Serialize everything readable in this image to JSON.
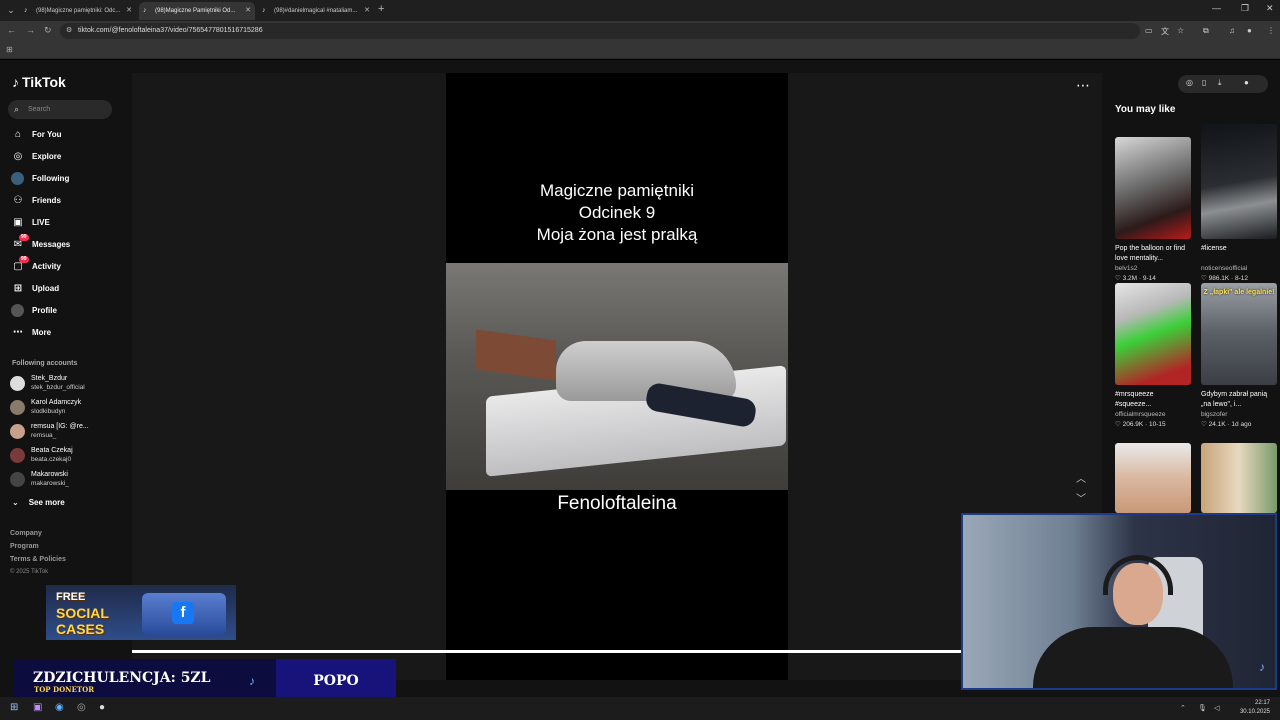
{
  "browser": {
    "tabs": [
      {
        "label": "(98)Magiczne pamiętniki: Odc..."
      },
      {
        "label": "(98)Magiczne Pamiętniki Od..."
      },
      {
        "label": "(98)#danielmagical #nataliam..."
      }
    ],
    "url": "tiktok.com/@fenoloftaleina37/video/7565477801516715286"
  },
  "sidebar": {
    "logo": "TikTok",
    "search_placeholder": "Search",
    "nav": [
      {
        "label": "For You",
        "icon": "home-icon"
      },
      {
        "label": "Explore",
        "icon": "compass-icon"
      },
      {
        "label": "Following",
        "icon": "following-avatar-icon"
      },
      {
        "label": "Friends",
        "icon": "friends-icon"
      },
      {
        "label": "LIVE",
        "icon": "live-icon"
      },
      {
        "label": "Messages",
        "icon": "messages-icon",
        "badge": "99"
      },
      {
        "label": "Activity",
        "icon": "activity-icon",
        "badge": "99"
      },
      {
        "label": "Upload",
        "icon": "upload-icon"
      },
      {
        "label": "Profile",
        "icon": "profile-avatar-icon"
      },
      {
        "label": "More",
        "icon": "more-icon"
      }
    ],
    "following_title": "Following accounts",
    "accounts": [
      {
        "name": "Stek_Bzdur",
        "handle": "stek_bzdur_official"
      },
      {
        "name": "Karol Adamczyk",
        "handle": "slodkibudyn"
      },
      {
        "name": "remsua [IG: @re...",
        "handle": "remsua_"
      },
      {
        "name": "Beata Czekaj",
        "handle": "beata.czekaj0"
      },
      {
        "name": "Makarowski",
        "handle": "makarowski_"
      }
    ],
    "see_more": "See more",
    "footer": [
      "Company",
      "Program",
      "Terms & Policies"
    ],
    "copyright": "© 2025 TikTok"
  },
  "video": {
    "caption_lines": [
      "Magiczne pamiętniki",
      "Odcinek 9",
      "Moja żona jest pralką"
    ],
    "author_overlay": "Fenoloftaleina",
    "progress": 1.0
  },
  "right": {
    "title": "You may like",
    "cards": [
      {
        "title": "Pop the balloon or find love mentality...",
        "author": "belv1s2",
        "likes": "3.2M",
        "date": "9-14",
        "overlay": ""
      },
      {
        "title": "#license",
        "author": "noticenseofficial",
        "likes": "986.1K",
        "date": "8-12",
        "overlay": ""
      },
      {
        "title": "#mrsqueeze #squeeze...",
        "author": "officialmrsqueeze",
        "likes": "206.9K",
        "date": "10-15",
        "overlay": ""
      },
      {
        "title": "Gdybym zabrał panią „na lewo\", i...",
        "author": "bigszofer",
        "likes": "24.1K",
        "date": "1d ago",
        "overlay": "Z „łapki\" ale legalnie!"
      },
      {
        "title": "",
        "author": "",
        "likes": "",
        "date": "",
        "overlay": ""
      },
      {
        "title": "",
        "author": "",
        "likes": "",
        "date": "",
        "overlay": ""
      }
    ]
  },
  "stream": {
    "promo_line1": "FREE",
    "promo_line2": "SOCIAL",
    "promo_line3": "CASES",
    "donate_main": "ZDZICHULENCJA: 5ZL",
    "donate_sub": "TOP DONETOR",
    "donate_right": "POPO"
  },
  "taskbar": {
    "time": "22:17",
    "date": "30.10.2025"
  }
}
